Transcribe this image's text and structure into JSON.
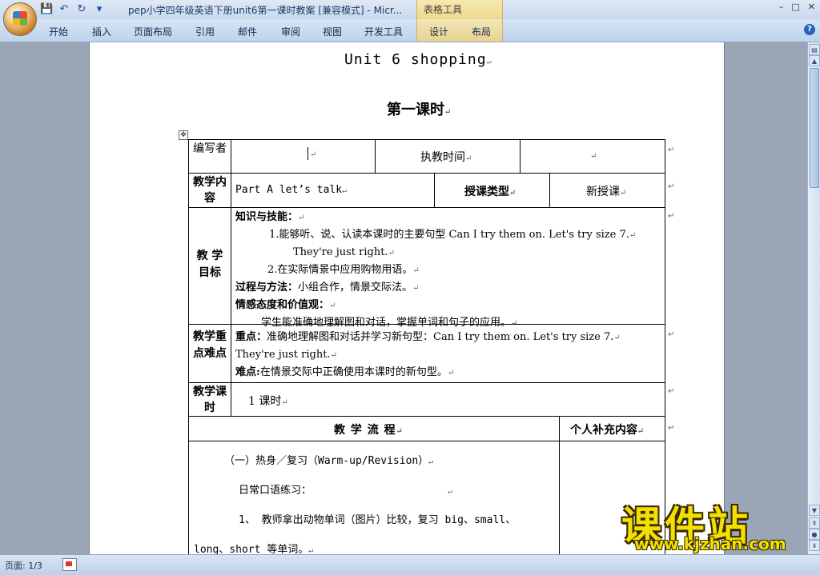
{
  "window": {
    "title": "pep小学四年级英语下册unit6第一课时教案 [兼容模式] - Micr...",
    "context_tab_group": "表格工具",
    "controls": [
      "–",
      "□",
      "✕"
    ]
  },
  "ribbon": {
    "tabs": [
      "开始",
      "插入",
      "页面布局",
      "引用",
      "邮件",
      "审阅",
      "视图",
      "开发工具",
      "设计",
      "布局"
    ],
    "help": "?"
  },
  "quick_access": {
    "icons": [
      "save-icon",
      "undo-icon",
      "redo-icon",
      "customize-icon"
    ],
    "glyphs": [
      "💾",
      "↶",
      "↻",
      "▾"
    ]
  },
  "document": {
    "unit_title": "Unit 6  shopping",
    "lesson_title": "第一课时",
    "table": {
      "row1": {
        "label": "编写者",
        "value": "",
        "label2": "执教时间",
        "value2": ""
      },
      "row2": {
        "label": "教学内容",
        "value": "Part A  let’s talk",
        "label2": "授课类型",
        "value2": "新授课"
      },
      "row3": {
        "label": "教 学目标",
        "heading1": "知识与技能：",
        "item1": "1.能够听、说、认读本课时的主要句型 Can I try them on. Let's try size 7.",
        "item1b": "They're just right.",
        "item2": "2.在实际情景中应用购物用语。",
        "heading2": "过程与方法：",
        "text2": "小组合作，情景交际法。",
        "heading3": "情感态度和价值观：",
        "text3": "学生能准确地理解图和对话，掌握单词和句子的应用。"
      },
      "row4": {
        "label": "教学重点难点",
        "key_label": "重点：",
        "key_text": "准确地理解图和对话并学习新句型：Can I try them on. Let's try size 7.",
        "key_text2": "They're just right.",
        "hard_label": "难点:",
        "hard_text": "在情景交际中正确使用本课时的新句型。"
      },
      "row5": {
        "label": "教学课时",
        "value": "1 课时"
      },
      "row6": {
        "label": "教 学 流  程",
        "label2": "个人补充内容"
      },
      "row7": {
        "section": "（一）热身／复习（Warm-up/Revision）",
        "line1": "日常口语练习：",
        "line2": "1、 教师拿出动物单词（图片）比较，复习 big、small、",
        "line3": "long、short 等单词。"
      }
    }
  },
  "status": {
    "page": "页面: 1/3"
  },
  "watermark": {
    "main": "课件站",
    "url": "www.kjzhan.com"
  }
}
